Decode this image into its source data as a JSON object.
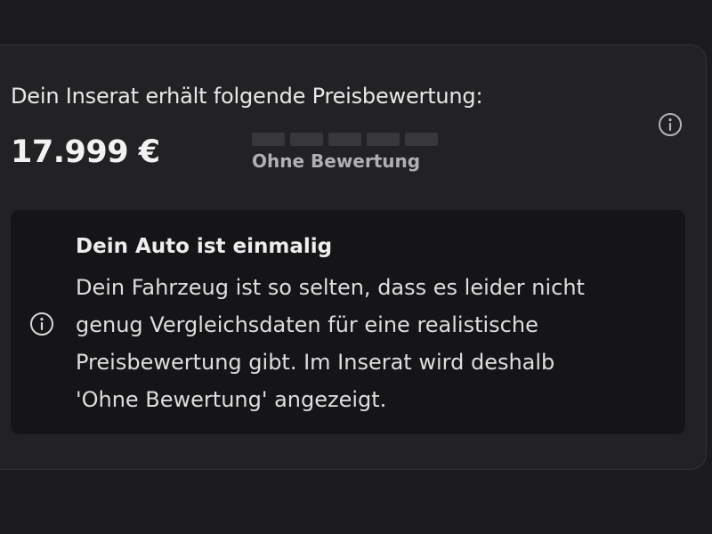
{
  "price_rating": {
    "heading": "Dein Inserat erhält folgende Preisbewertung:",
    "price": "17.999 €",
    "rating_label": "Ohne Bewertung",
    "rating_segments": 5,
    "rating_filled": 0
  },
  "notice": {
    "title": "Dein Auto ist einmalig",
    "body_lines": [
      "Dein Fahrzeug ist so selten, dass es leider nicht",
      "genug Vergleichsdaten für eine realistische",
      "Preisbewertung gibt. Im Inserat wird deshalb",
      "'Ohne Bewertung' angezeigt."
    ]
  },
  "icons": {
    "top_right": "info-icon",
    "notice": "info-icon"
  },
  "colors": {
    "background": "#1b1b1d",
    "card": "#222224",
    "notice_background": "#151518",
    "empty_segment": "#38383b"
  }
}
